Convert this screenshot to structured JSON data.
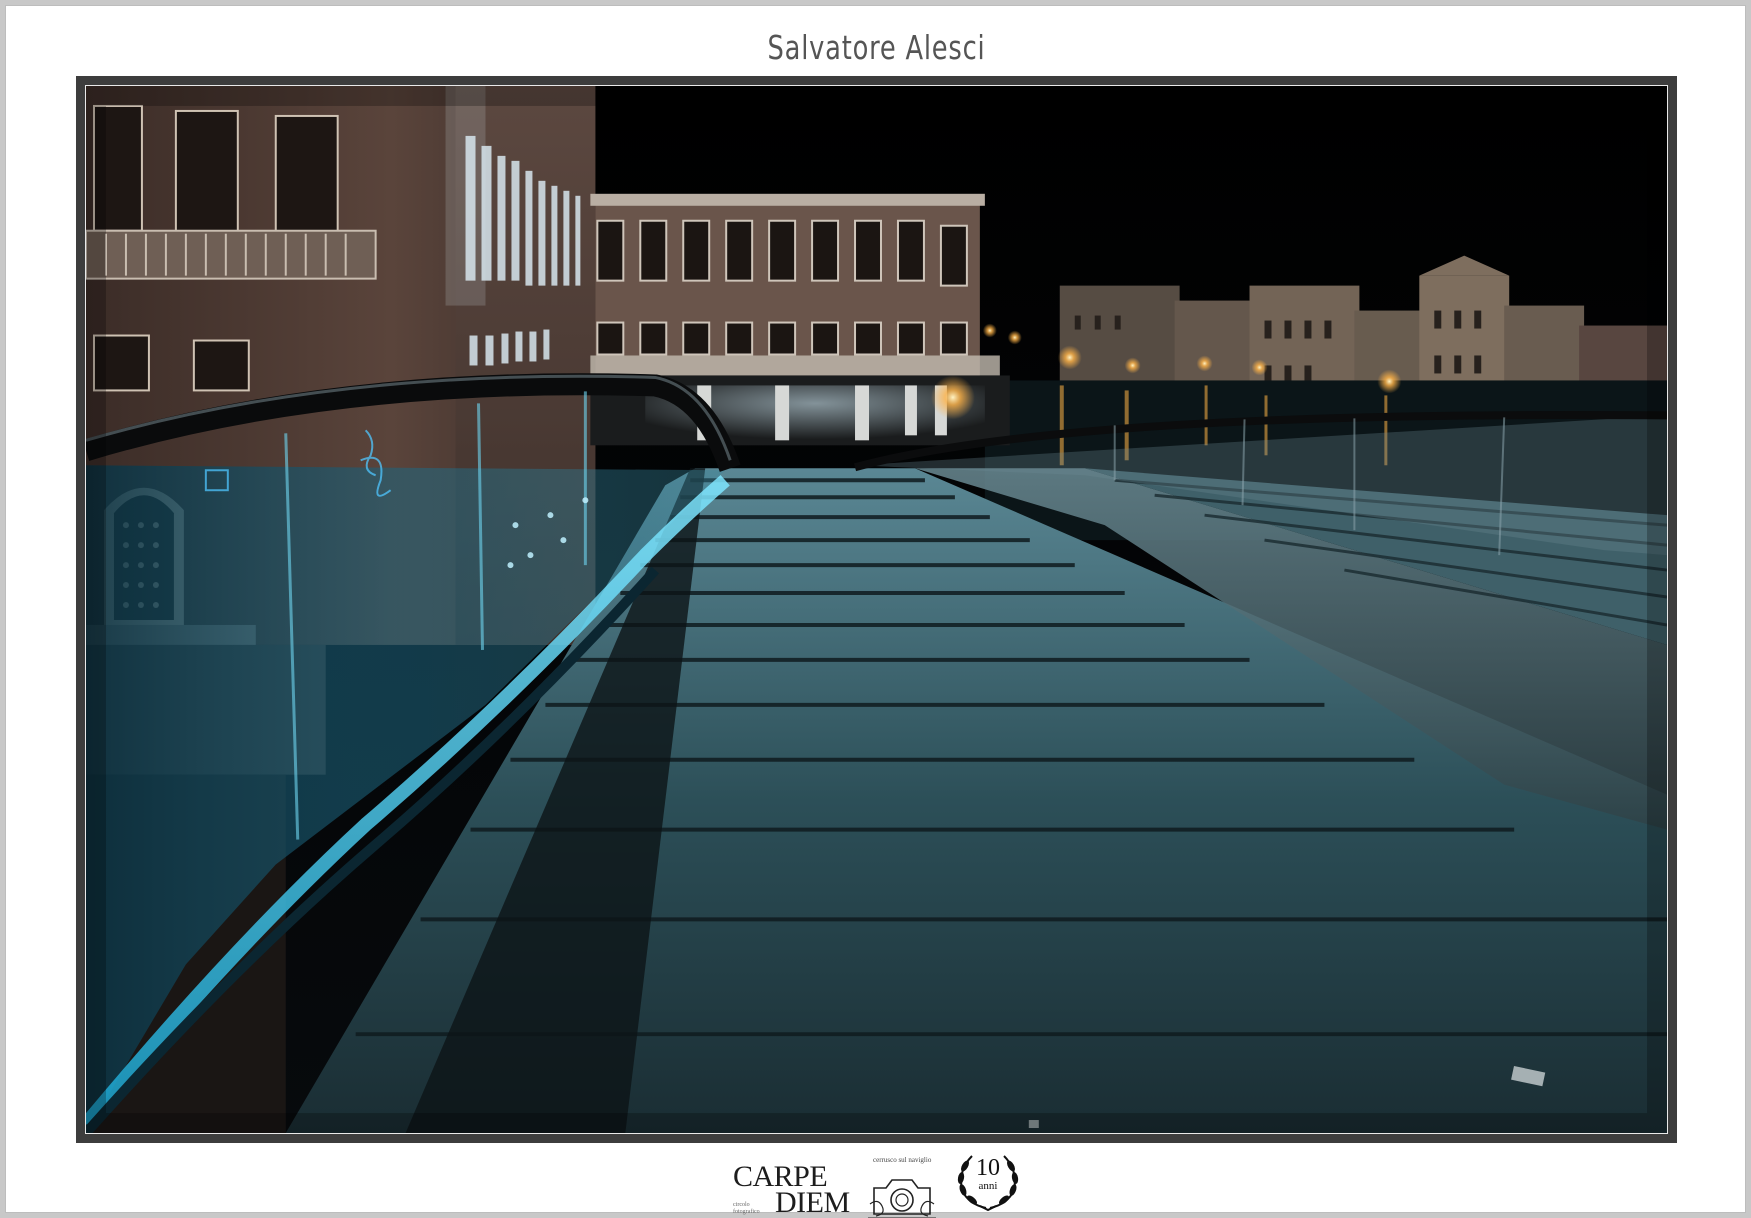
{
  "header": {
    "author": "Salvatore Alesci"
  },
  "photo": {
    "subject": "night-bridge-venice-photo",
    "palette": {
      "sky": "#020405",
      "glass_glow": "#3fb8d8",
      "steps": "#2f5a63",
      "brick": "#4a3a34",
      "lamp": "#ffb347"
    }
  },
  "footer": {
    "logo": {
      "word1": "CARPE",
      "word2": "DIEM",
      "tagline": "cerrusco sul naviglio",
      "sub1": "circolo",
      "sub2": "fotografico",
      "icon": "camera-icon"
    },
    "anniversary": {
      "number": "10",
      "word": "anni",
      "icon": "laurel-icon"
    }
  }
}
